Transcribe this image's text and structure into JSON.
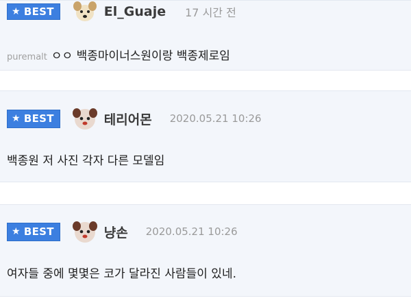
{
  "comments": [
    {
      "badge": "BEST",
      "avatar_icon": "dog-avatar-icon",
      "nickname": "El_Guaje",
      "time": "17 시간 전",
      "reply_to": "puremalt",
      "text": "ㅇㅇ 백종마이너스원이랑 백종제로임"
    },
    {
      "badge": "BEST",
      "avatar_icon": "dog-avatar-icon",
      "nickname": "테리어몬",
      "time": "2020.05.21 10:26",
      "text": "백종원 저 사진 각자 다른 모델임"
    },
    {
      "badge": "BEST",
      "avatar_icon": "dog-avatar-icon",
      "nickname": "냥손",
      "time": "2020.05.21 10:26",
      "text": "여자들 중에 몇몇은 코가 달라진 사람들이 있네."
    }
  ],
  "colors": {
    "badge_bg": "#3c7fe0",
    "card_bg": "#f3f6fb",
    "nick": "#3a3a3a",
    "date": "#9a9a9a"
  }
}
